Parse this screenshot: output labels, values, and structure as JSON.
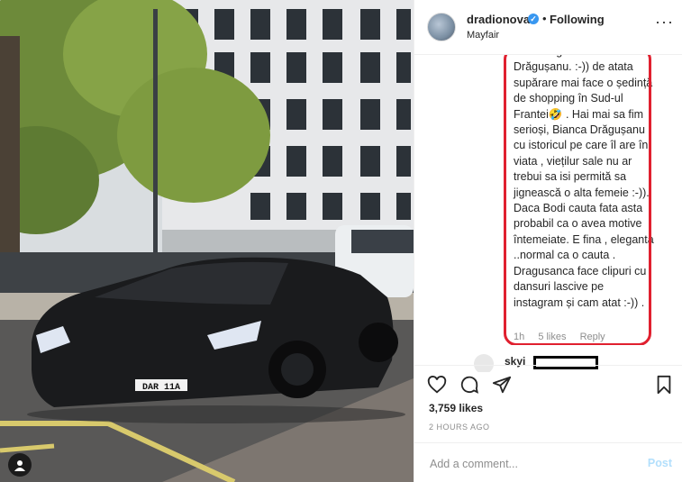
{
  "header": {
    "username": "dradionova",
    "separator": "•",
    "follow_label": "Following",
    "location": "Mayfair",
    "more_label": "···"
  },
  "comment": {
    "text": "ca-i denigrează Bianca Drăgușanu. :-)) de atata supărare mai face o ședință de shopping în Sud-ul Frantei🤣 . Hai mai sa fim serioși, Bianca Drăgușanu cu istoricul pe care îl are în viata , viețilur sale nu ar trebui sa isi permită sa jignească o alta femeie :-)). Daca Bodi cauta fata asta probabil ca o avea motive întemeiate. E fina , eleganta ..normal ca o cauta . Dragusanca face clipuri cu dansuri lascive pe instagram și cam atat :-)) .",
    "age": "1h",
    "likes": "5 likes",
    "reply": "Reply"
  },
  "next_comment": {
    "username": "skyi"
  },
  "post": {
    "likes_count": "3,759 likes",
    "time_ago": "2 HOURS AGO",
    "license_plate": "DAR 11A"
  },
  "comment_box": {
    "placeholder": "Add a comment...",
    "post_label": "Post"
  },
  "colors": {
    "accent": "#3897f0",
    "highlight": "#e0202f",
    "post_disabled": "#b2dffc"
  },
  "icons": [
    "heart-icon",
    "comment-icon",
    "share-icon",
    "bookmark-icon",
    "user-tag-icon",
    "verified-icon"
  ]
}
